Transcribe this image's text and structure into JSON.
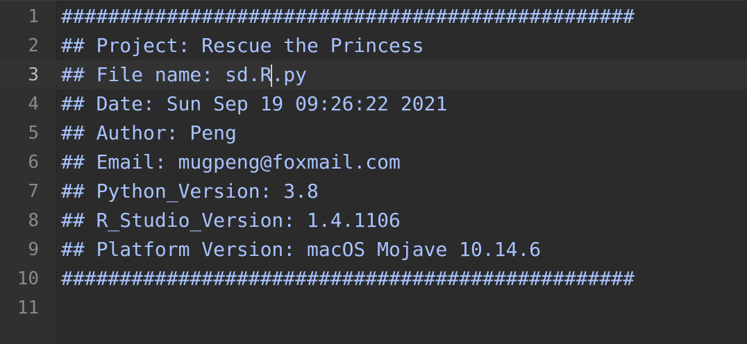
{
  "editor": {
    "colors": {
      "background": "#2b2b2b",
      "gutter": "#303030",
      "comment": "#a8c3ff",
      "line_number": "#8a8a8a"
    },
    "lines": [
      {
        "number": "1",
        "text": "#################################################"
      },
      {
        "number": "2",
        "text": "## Project: Rescue the Princess"
      },
      {
        "number": "3",
        "text_before_cursor": "## File name: sd.R",
        "text_after_cursor": ".py"
      },
      {
        "number": "4",
        "text": "## Date: Sun Sep 19 09:26:22 2021"
      },
      {
        "number": "5",
        "text": "## Author: Peng"
      },
      {
        "number": "6",
        "text": "## Email: mugpeng@foxmail.com"
      },
      {
        "number": "7",
        "text": "## Python_Version: 3.8"
      },
      {
        "number": "8",
        "text": "## R_Studio_Version: 1.4.1106"
      },
      {
        "number": "9",
        "text": "## Platform Version: macOS Mojave 10.14.6"
      },
      {
        "number": "10",
        "text": "#################################################"
      },
      {
        "number": "11",
        "text": ""
      }
    ]
  }
}
